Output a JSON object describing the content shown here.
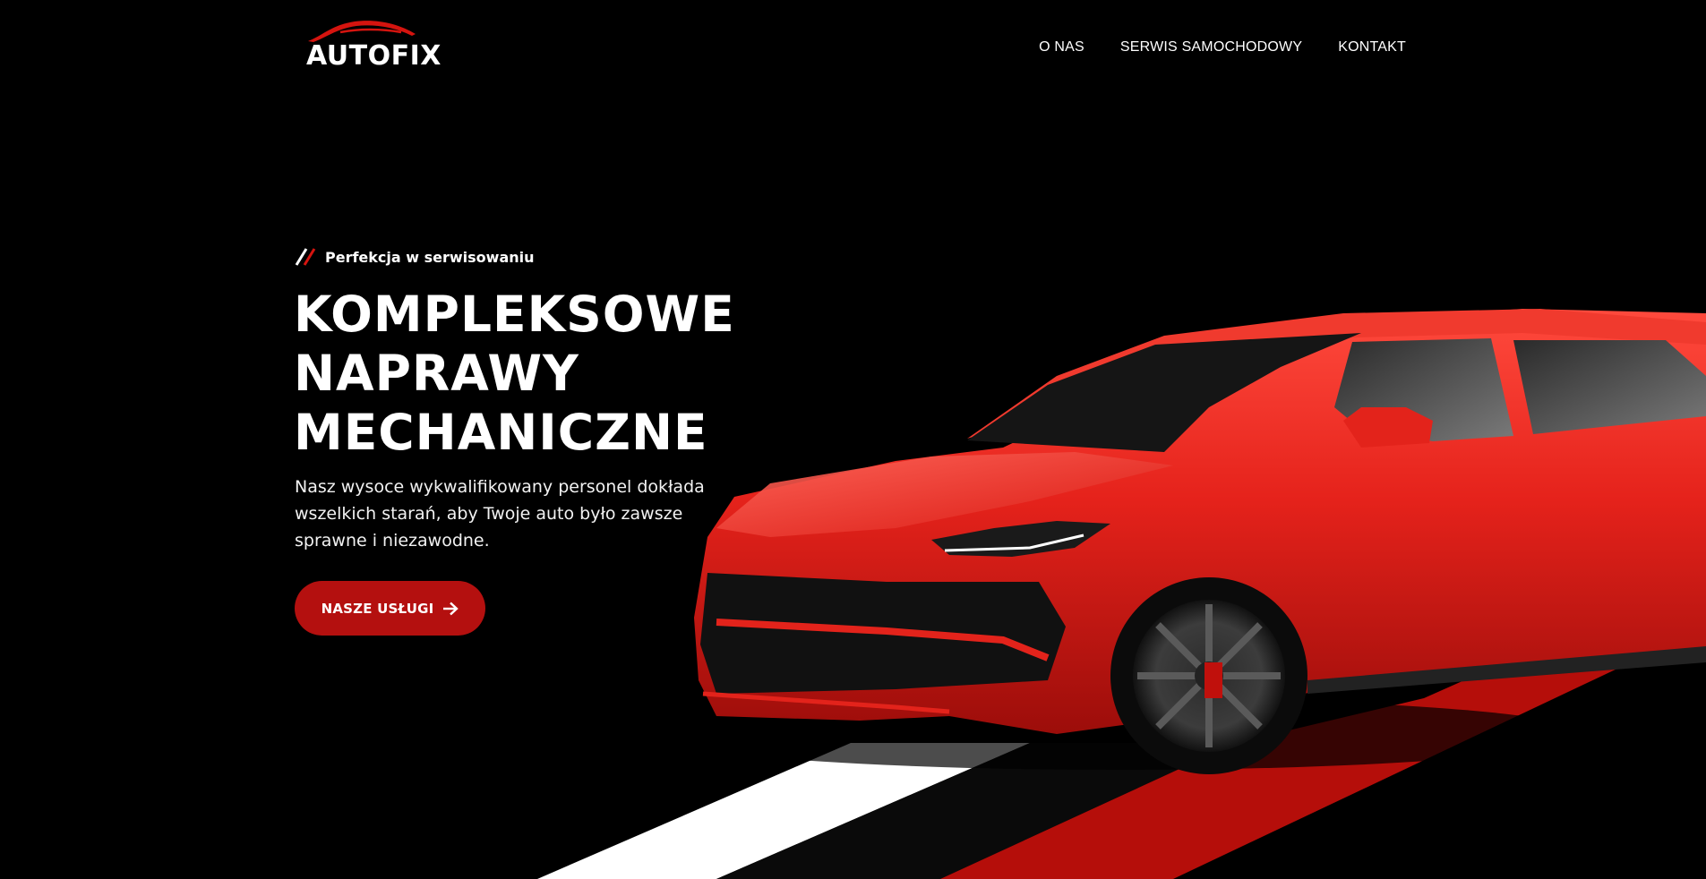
{
  "brand": {
    "name": "AUTOFIX",
    "accent_color": "#b4100f",
    "logo_icon": "car-silhouette-icon"
  },
  "nav": {
    "items": [
      {
        "label": "O NAS"
      },
      {
        "label": "SERWIS SAMOCHODOWY"
      },
      {
        "label": "KONTAKT"
      }
    ]
  },
  "hero": {
    "tagline": "Perfekcja w serwisowaniu",
    "tagline_icon": "double-slash-icon",
    "title_lines": [
      "KOMPLEKSOWE",
      "NAPRAWY",
      "MECHANICZNE"
    ],
    "description": "Nasz wysoce wykwalifikowany personel dokłada wszelkich starań, aby Twoje auto było zawsze sprawne i niezawodne.",
    "cta_label": "NASZE USŁUGI",
    "cta_icon": "arrow-right-icon",
    "image": "red-suv-car-image"
  }
}
